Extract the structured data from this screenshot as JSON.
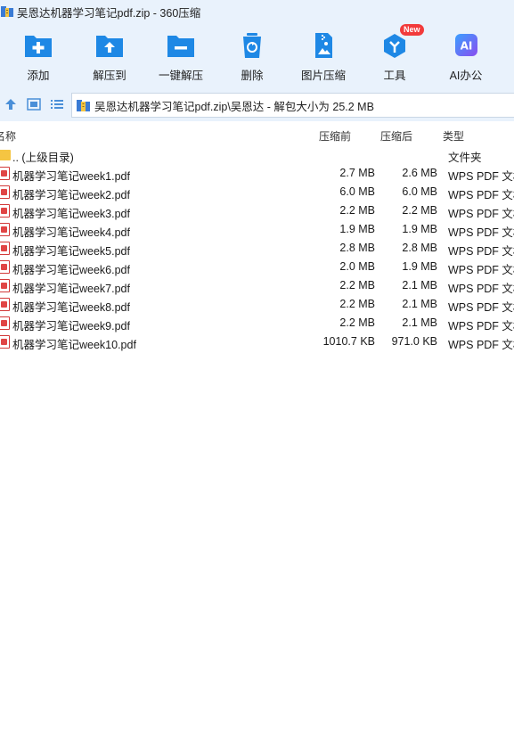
{
  "window": {
    "title": "吴恩达机器学习笔记pdf.zip - 360压缩"
  },
  "toolbar": {
    "buttons": [
      {
        "label": "添加",
        "icon": "add-folder-icon",
        "color": "#1e88e5"
      },
      {
        "label": "解压到",
        "icon": "extract-folder-icon",
        "color": "#1e88e5"
      },
      {
        "label": "一键解压",
        "icon": "quick-extract-icon",
        "color": "#1e88e5"
      },
      {
        "label": "删除",
        "icon": "trash-icon",
        "color": "#1e88e5"
      },
      {
        "label": "图片压缩",
        "icon": "image-compress-icon",
        "color": "#1e88e5"
      },
      {
        "label": "工具",
        "icon": "tools-cube-icon",
        "color": "#1e88e5",
        "badge": "New"
      },
      {
        "label": "AI办公",
        "icon": "ai-office-icon",
        "color": "#6a5cf0",
        "icon_text": "AI"
      }
    ]
  },
  "address": {
    "path": "吴恩达机器学习笔记pdf.zip\\吴恩达 - 解包大小为 25.2 MB"
  },
  "columns": {
    "name": "名称",
    "packed": "压缩前",
    "size": "压缩后",
    "type": "类型"
  },
  "files": [
    {
      "name": ".. (上级目录)",
      "packed": "",
      "size": "",
      "type": "文件夹",
      "icon": "folder-icon"
    },
    {
      "name": "机器学习笔记week1.pdf",
      "packed": "2.7 MB",
      "size": "2.6 MB",
      "type": "WPS PDF 文档",
      "icon": "pdf-file-icon"
    },
    {
      "name": "机器学习笔记week2.pdf",
      "packed": "6.0 MB",
      "size": "6.0 MB",
      "type": "WPS PDF 文档",
      "icon": "pdf-file-icon"
    },
    {
      "name": "机器学习笔记week3.pdf",
      "packed": "2.2 MB",
      "size": "2.2 MB",
      "type": "WPS PDF 文档",
      "icon": "pdf-file-icon"
    },
    {
      "name": "机器学习笔记week4.pdf",
      "packed": "1.9 MB",
      "size": "1.9 MB",
      "type": "WPS PDF 文档",
      "icon": "pdf-file-icon"
    },
    {
      "name": "机器学习笔记week5.pdf",
      "packed": "2.8 MB",
      "size": "2.8 MB",
      "type": "WPS PDF 文档",
      "icon": "pdf-file-icon"
    },
    {
      "name": "机器学习笔记week6.pdf",
      "packed": "2.0 MB",
      "size": "1.9 MB",
      "type": "WPS PDF 文档",
      "icon": "pdf-file-icon"
    },
    {
      "name": "机器学习笔记week7.pdf",
      "packed": "2.2 MB",
      "size": "2.1 MB",
      "type": "WPS PDF 文档",
      "icon": "pdf-file-icon"
    },
    {
      "name": "机器学习笔记week8.pdf",
      "packed": "2.2 MB",
      "size": "2.1 MB",
      "type": "WPS PDF 文档",
      "icon": "pdf-file-icon"
    },
    {
      "name": "机器学习笔记week9.pdf",
      "packed": "2.2 MB",
      "size": "2.1 MB",
      "type": "WPS PDF 文档",
      "icon": "pdf-file-icon"
    },
    {
      "name": "机器学习笔记week10.pdf",
      "packed": "1010.7 KB",
      "size": "971.0 KB",
      "type": "WPS PDF 文档",
      "icon": "pdf-file-icon"
    }
  ]
}
